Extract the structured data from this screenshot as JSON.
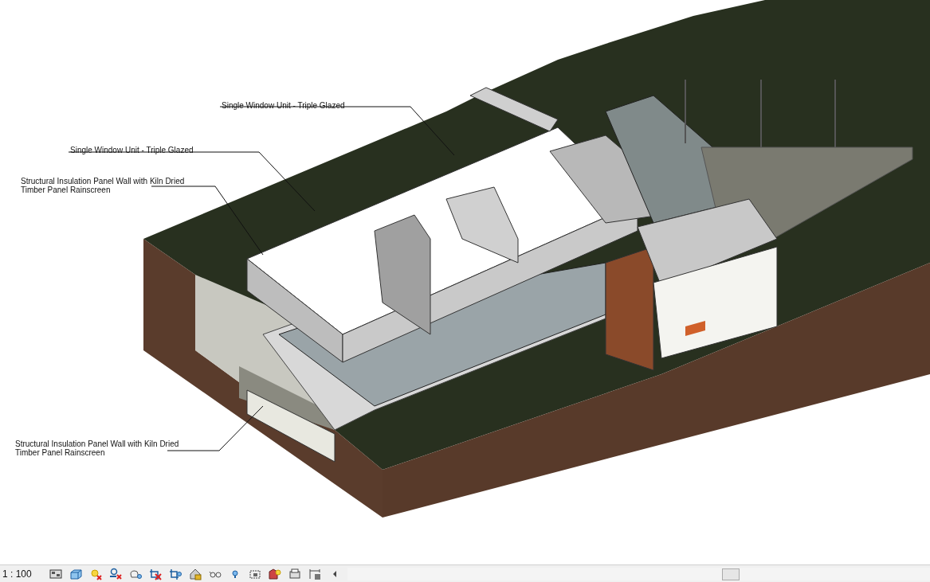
{
  "view": {
    "annotations": [
      {
        "text": "Single Window Unit - Triple Glazed"
      },
      {
        "text": "Single Window Unit - Triple Glazed"
      },
      {
        "text": "Structural Insulation Panel Wall with Kiln Dried Timber Panel Rainscreen"
      },
      {
        "text": "Structural Insulation Panel Wall with Kiln Dried Timber Panel Rainscreen"
      }
    ]
  },
  "status_bar": {
    "scale": "1 : 100"
  }
}
